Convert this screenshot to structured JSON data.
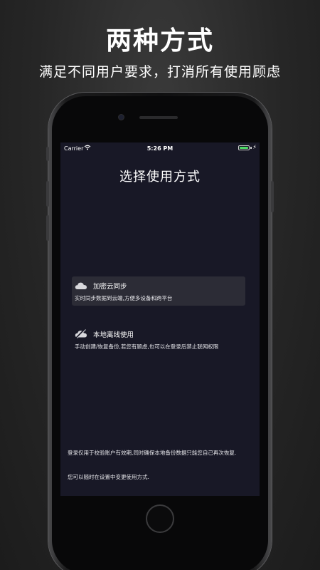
{
  "headline": "两种方式",
  "subheadline": "满足不同用户要求，打消所有使用顾虑",
  "status_bar": {
    "carrier": "Carrier",
    "time": "5:26 PM",
    "wifi_icon": "wifi-icon",
    "battery_icon": "battery-icon",
    "charging_icon": "charging-icon"
  },
  "screen": {
    "title": "选择使用方式",
    "options": [
      {
        "icon": "cloud-icon",
        "label": "加密云同步",
        "description": "实时同步数据到云端,方便多设备和跨平台"
      },
      {
        "icon": "offline-cloud-icon",
        "label": "本地离线使用",
        "description": "手动创建/恢复备份,若您有顾虑,也可以在登录后禁止联网权限"
      }
    ],
    "notes": [
      "登录仅用于校验账户有效期,同时确保本地备份数据只能您自己再次恢复.",
      "您可以随时在设置中变更使用方式."
    ]
  },
  "colors": {
    "screen_background": "#181826",
    "selected_option_background": "#2c2c36",
    "battery_fill": "#4cd964"
  }
}
